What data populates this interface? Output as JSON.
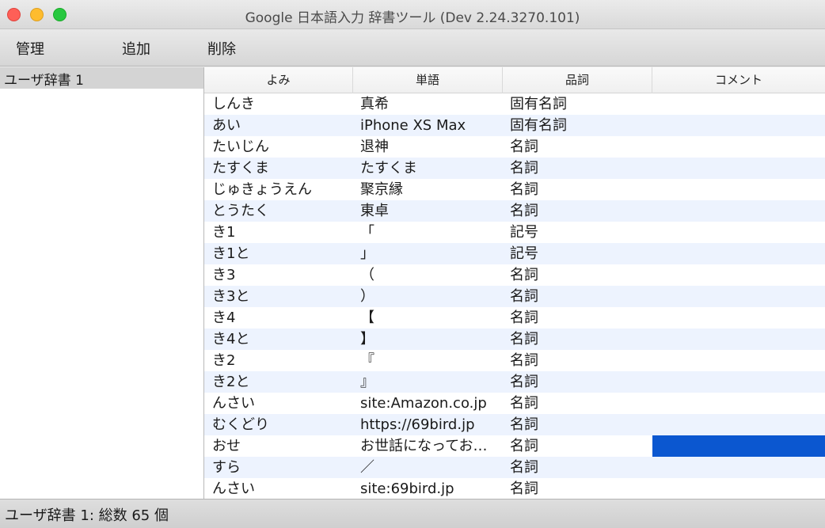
{
  "window": {
    "title": "Google 日本語入力 辞書ツール (Dev 2.24.3270.101)"
  },
  "toolbar": {
    "manage_label": "管理",
    "add_label": "追加",
    "delete_label": "削除"
  },
  "sidebar": {
    "dictionaries": [
      {
        "name": "ユーザ辞書 1",
        "selected": true
      }
    ]
  },
  "table": {
    "columns": [
      "よみ",
      "単語",
      "品詞",
      "コメント"
    ],
    "rows": [
      {
        "reading": "しんき",
        "word": "真希",
        "pos": "固有名詞",
        "comment": ""
      },
      {
        "reading": "あい",
        "word": "iPhone XS Max",
        "pos": "固有名詞",
        "comment": ""
      },
      {
        "reading": "たいじん",
        "word": "退神",
        "pos": "名詞",
        "comment": ""
      },
      {
        "reading": "たすくま",
        "word": "たすくま",
        "pos": "名詞",
        "comment": ""
      },
      {
        "reading": "じゅきょうえん",
        "word": "聚京縁",
        "pos": "名詞",
        "comment": ""
      },
      {
        "reading": "とうたく",
        "word": "東卓",
        "pos": "名詞",
        "comment": ""
      },
      {
        "reading": "き1",
        "word": "「",
        "pos": "記号",
        "comment": ""
      },
      {
        "reading": "き1と",
        "word": "」",
        "pos": "記号",
        "comment": ""
      },
      {
        "reading": "き3",
        "word": "（",
        "pos": "名詞",
        "comment": ""
      },
      {
        "reading": "き3と",
        "word": "）",
        "pos": "名詞",
        "comment": ""
      },
      {
        "reading": "き4",
        "word": "【",
        "pos": "名詞",
        "comment": ""
      },
      {
        "reading": "き4と",
        "word": "】",
        "pos": "名詞",
        "comment": ""
      },
      {
        "reading": "き2",
        "word": "『",
        "pos": "名詞",
        "comment": ""
      },
      {
        "reading": "き2と",
        "word": "』",
        "pos": "名詞",
        "comment": ""
      },
      {
        "reading": "んさい",
        "word": "site:Amazon.co.jp",
        "pos": "名詞",
        "comment": ""
      },
      {
        "reading": "むくどり",
        "word": "https://69bird.jp",
        "pos": "名詞",
        "comment": ""
      },
      {
        "reading": "おせ",
        "word": "お世話になってお…",
        "pos": "名詞",
        "comment": "",
        "comment_selected": true
      },
      {
        "reading": "すら",
        "word": "／",
        "pos": "名詞",
        "comment": ""
      },
      {
        "reading": "んさい",
        "word": "site:69bird.jp",
        "pos": "名詞",
        "comment": ""
      }
    ]
  },
  "statusbar": {
    "text": "ユーザ辞書 1: 総数 65 個"
  },
  "colors": {
    "selection": "#0b57d0",
    "row_alt": "#edf3fe"
  }
}
